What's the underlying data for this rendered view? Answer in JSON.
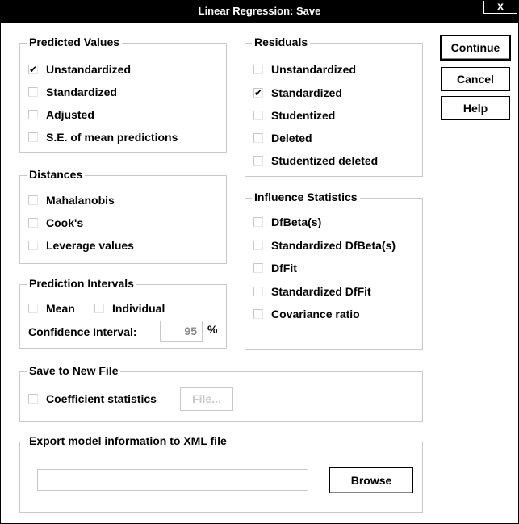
{
  "window": {
    "title": "Linear Regression: Save",
    "close_label": "x"
  },
  "predicted": {
    "legend": "Predicted Values",
    "items": [
      {
        "label": "Unstandardized",
        "checked": true
      },
      {
        "label": "Standardized",
        "checked": false
      },
      {
        "label": "Adjusted",
        "checked": false
      },
      {
        "label": "S.E. of mean predictions",
        "checked": false
      }
    ]
  },
  "distances": {
    "legend": "Distances",
    "items": [
      {
        "label": "Mahalanobis",
        "checked": false
      },
      {
        "label": "Cook's",
        "checked": false
      },
      {
        "label": "Leverage values",
        "checked": false
      }
    ]
  },
  "prediction_intervals": {
    "legend": "Prediction Intervals",
    "mean_label": "Mean",
    "individual_label": "Individual",
    "confidence_label": "Confidence Interval:",
    "confidence_value": "95",
    "percent": "%"
  },
  "residuals": {
    "legend": "Residuals",
    "items": [
      {
        "label": "Unstandardized",
        "checked": false
      },
      {
        "label": "Standardized",
        "checked": true
      },
      {
        "label": "Studentized",
        "checked": false
      },
      {
        "label": "Deleted",
        "checked": false
      },
      {
        "label": "Studentized deleted",
        "checked": false
      }
    ]
  },
  "influence": {
    "legend": "Influence Statistics",
    "items": [
      {
        "label": "DfBeta(s)",
        "checked": false
      },
      {
        "label": "Standardized DfBeta(s)",
        "checked": false
      },
      {
        "label": "DfFit",
        "checked": false
      },
      {
        "label": "Standardized DfFit",
        "checked": false
      },
      {
        "label": "Covariance ratio",
        "checked": false
      }
    ]
  },
  "save_new_file": {
    "legend": "Save to New File",
    "coef_label": "Coefficient statistics",
    "file_button": "File..."
  },
  "export": {
    "legend": "Export model information to XML file",
    "path_value": "",
    "browse_button": "Browse"
  },
  "buttons": {
    "continue": "Continue",
    "cancel": "Cancel",
    "help": "Help"
  }
}
